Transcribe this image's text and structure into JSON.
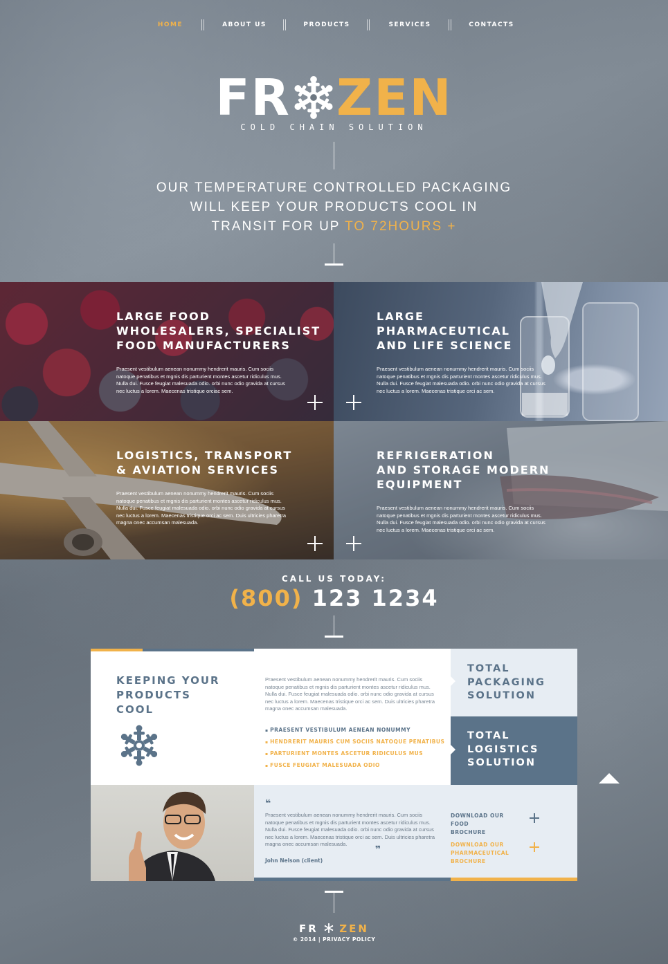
{
  "nav": {
    "items": [
      "HOME",
      "ABOUT US",
      "PRODUCTS",
      "SERVICES",
      "CONTACTS"
    ],
    "active": "HOME"
  },
  "hero": {
    "logo_left": "FR",
    "logo_right": "ZEN",
    "tagline": "COLD CHAIN SOLUTION",
    "line1": "OUR TEMPERATURE CONTROLLED PACKAGING",
    "line2": "WILL KEEP YOUR PRODUCTS COOL IN",
    "line3_prefix": "TRANSIT FOR UP ",
    "line3_highlight": "TO 72HOURS +"
  },
  "tiles": [
    {
      "title_lines": [
        "LARGE FOOD",
        "WHOLESALERS, SPECIALIST",
        "FOOD MANUFACTURERS"
      ],
      "body": "Praesent vestibulum aenean nonummy hendrerit mauris. Cum sociis natoque penatibus et mgnis dis parturient montes ascetur ridiculus mus. Nulla dui. Fusce feugiat malesuada odio. orbi nunc odio gravida at cursus nec luctus a lorem. Maecenas tristique orciac sem."
    },
    {
      "title_lines": [
        "LARGE",
        "PHARMACEUTICAL",
        "AND LIFE SCIENCE"
      ],
      "body": "Praesent vestibulum aenean nonummy hendrerit mauris. Cum sociis natoque penatibus et mgnis dis parturient montes ascetur ridiculus mus. Nulla dui. Fusce feugiat malesuada odio. orbi nunc odio gravida at cursus nec luctus a lorem. Maecenas tristique orci ac sem."
    },
    {
      "title_lines": [
        "LOGISTICS, TRANSPORT",
        "& AVIATION SERVICES"
      ],
      "body": "Praesent vestibulum aenean nonummy hendrerit mauris. Cum sociis natoque penatibus et mgnis dis parturient montes ascetur ridiculus mus. Nulla dui. Fusce feugiat malesuada odio. orbi nunc odio gravida at cursus nec luctus a lorem. Maecenas tristique orci ac sem. Duis ultricies pharetra magna onec accumsan malesuada."
    },
    {
      "title_lines": [
        "REFRIGERATION",
        "AND STORAGE MODERN",
        "EQUIPMENT"
      ],
      "body": "Praesent vestibulum aenean nonummy hendrerit mauris. Cum sociis natoque penatibus et mgnis dis parturient montes ascetur ridiculus mus. Nulla dui. Fusce feugiat malesuada odio. orbi nunc odio gravida at cursus nec luctus a lorem. Maecenas tristique orci ac sem."
    }
  ],
  "call": {
    "label": "CALL US TODAY:",
    "area": "(800)",
    "number": "123 1234"
  },
  "info": {
    "heading_lines": [
      "KEEPING YOUR",
      "PRODUCTS",
      "COOL"
    ],
    "paragraph": "Praesent vestibulum aenean nonummy hendrerit mauris. Cum sociis natoque penatibus et mgnis dis parturient montes ascetur ridiculus mus. Nulla dui. Fusce feugiat malesuada odio. orbi nunc odio gravida at cursus nec luctus a lorem. Maecenas tristique orci ac sem. Duis ultricies pharetra magna onec accumsan malesuada.",
    "bullets": [
      "PRAESENT VESTIBULUM AENEAN NONUMMY",
      "HENDRERIT MAURIS CUM SOCIIS NATOQUE PENATIBUS",
      "PARTURIENT MONTES ASCETUR RIDICULUS MUS",
      "FUSCE FEUGIAT MALESUADA ODIO"
    ],
    "side_light_lines": [
      "TOTAL",
      "PACKAGING",
      "SOLUTION"
    ],
    "side_dark_lines": [
      "TOTAL",
      "LOGISTICS",
      "SOLUTION"
    ]
  },
  "testimonial": {
    "text": "Praesent vestibulum aenean nonummy hendrerit mauris. Cum sociis natoque penatibus et mgnis dis parturient montes ascetur ridiculus mus. Nulla dui. Fusce feugiat malesuada odio. orbi nunc odio gravida at cursus nec luctus a lorem. Maecenas tristique orci ac sem. Duis ultricies pharetra magna onec accumsan malesuada.",
    "author": "John Nelson (client)",
    "download1_lines": [
      "DOWNLOAD OUR FOOD",
      "BROCHURE"
    ],
    "download2_lines": [
      "DOWNLOAD OUR",
      "PHARMACEUTICAL",
      "BROCHURE"
    ]
  },
  "footer": {
    "logo_left": "FR",
    "logo_right": "ZEN",
    "copyright": "© 2014 | ",
    "privacy": "PRIVACY POLICY"
  },
  "colors": {
    "accent": "#f1b24a",
    "steel": "#5b7389",
    "light_panel": "#e7edf3"
  }
}
